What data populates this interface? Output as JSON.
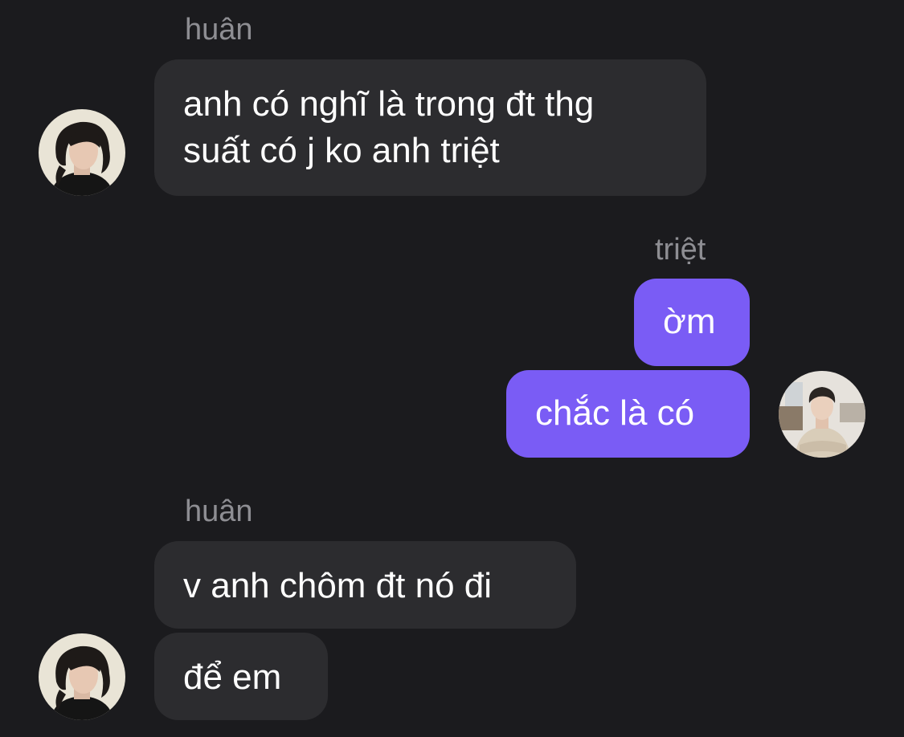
{
  "chat": {
    "groups": [
      {
        "sender": "huân",
        "avatar_icon": "user-avatar-huan",
        "messages": [
          {
            "lines": [
              "anh có nghĩ là trong đt thg",
              "suất có j ko anh triệt"
            ]
          }
        ]
      },
      {
        "sender": "triệt",
        "avatar_icon": "user-avatar-triet",
        "messages": [
          {
            "lines": [
              "ờm"
            ]
          },
          {
            "lines": [
              "chắc là có"
            ]
          }
        ]
      },
      {
        "sender": "huân",
        "avatar_icon": "user-avatar-huan",
        "messages": [
          {
            "lines": [
              "v anh chôm đt nó đi"
            ]
          },
          {
            "lines": [
              "để em"
            ]
          }
        ]
      }
    ]
  },
  "colors": {
    "background": "#1b1b1e",
    "incoming_bubble": "#2c2c2f",
    "outgoing_bubble": "#7a5cf5",
    "sender_label": "#8e8e93",
    "message_text": "#ffffff"
  }
}
